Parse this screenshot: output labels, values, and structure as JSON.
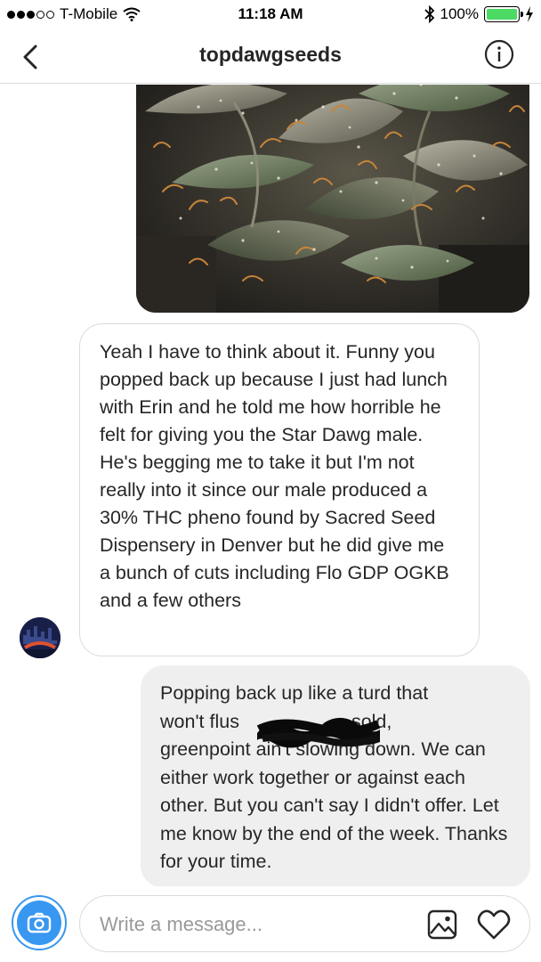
{
  "status_bar": {
    "carrier": "T-Mobile",
    "time": "11:18 AM",
    "battery_text": "100%",
    "battery_level": 1.0,
    "signal_filled": 3,
    "signal_total": 5,
    "icons": [
      "wifi-icon",
      "bluetooth-icon",
      "charging-icon"
    ]
  },
  "header": {
    "title": "topdawgseeds",
    "back_icon": "chevron-left-icon",
    "info_icon": "info-icon"
  },
  "messages": {
    "incoming_text": "Yeah I have to think about it. Funny you popped back up because I just had lunch with Erin and he told me how horrible he felt for giving you the Star Dawg male. He's begging me to take it but I'm not really into it since our male produced a 30%  THC pheno found by Sacred Seed Dispensery in Denver but he did give me a bunch of cuts including Flo GDP OGKB and a few others",
    "outgoing_line1": "Popping back up like a turd that",
    "outgoing_line2_start": "won't flus",
    "outgoing_line2_end": "sold,",
    "outgoing_rest": "greenpoint ain't slowing down. We can either work together or against each other. But you can't say I didn't offer. Let me know by the end of the week. Thanks for your time."
  },
  "composer": {
    "placeholder": "Write a message...",
    "camera_icon": "camera-icon",
    "gallery_icon": "gallery-icon",
    "heart_icon": "heart-icon"
  },
  "colors": {
    "accent": "#3897f0",
    "battery": "#4cd964",
    "incoming_bubble_border": "#dbdbdb",
    "outgoing_bubble_bg": "#efefef"
  }
}
